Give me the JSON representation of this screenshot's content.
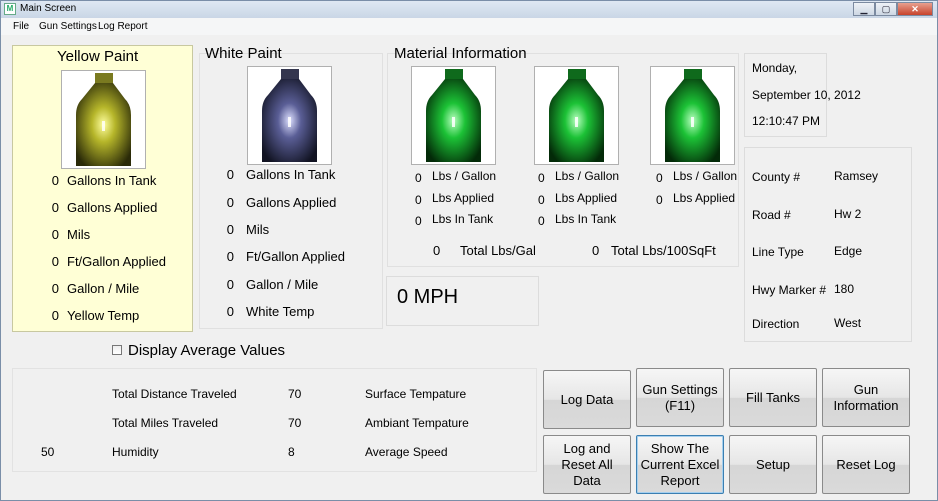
{
  "window": {
    "title": "Main Screen",
    "icon": "app-icon",
    "icon_glyph": "M"
  },
  "menu": {
    "items": [
      "File",
      "Gun Settings",
      "Log Report"
    ]
  },
  "yellow": {
    "title": "Yellow Paint",
    "rows": [
      {
        "value": "0",
        "label": "Gallons In Tank"
      },
      {
        "value": "0",
        "label": "Gallons Applied"
      },
      {
        "value": "0",
        "label": "Mils"
      },
      {
        "value": "0",
        "label": "Ft/Gallon Applied"
      },
      {
        "value": "0",
        "label": "Gallon / Mile"
      },
      {
        "value": "0",
        "label": "Yellow Temp"
      }
    ]
  },
  "white": {
    "title": "White Paint",
    "rows": [
      {
        "value": "0",
        "label": "Gallons In Tank"
      },
      {
        "value": "0",
        "label": "Gallons Applied"
      },
      {
        "value": "0",
        "label": "Mils"
      },
      {
        "value": "0",
        "label": "Ft/Gallon Applied"
      },
      {
        "value": "0",
        "label": "Gallon / Mile"
      },
      {
        "value": "0",
        "label": "White Temp"
      }
    ]
  },
  "material": {
    "title": "Material Information",
    "bins": [
      {
        "rows": [
          {
            "value": "0",
            "label": "Lbs / Gallon"
          },
          {
            "value": "0",
            "label": "Lbs Applied"
          },
          {
            "value": "0",
            "label": "Lbs In Tank"
          }
        ]
      },
      {
        "rows": [
          {
            "value": "0",
            "label": "Lbs / Gallon"
          },
          {
            "value": "0",
            "label": "Lbs Applied"
          },
          {
            "value": "0",
            "label": "Lbs In Tank"
          }
        ]
      },
      {
        "rows": [
          {
            "value": "0",
            "label": "Lbs / Gallon"
          },
          {
            "value": "0",
            "label": "Lbs Applied"
          }
        ]
      }
    ],
    "total_lbs_gal": {
      "value": "0",
      "label": "Total Lbs/Gal"
    },
    "total_lbs_sqft": {
      "value": "0",
      "label": "Total Lbs/100SqFt"
    }
  },
  "datetime": {
    "day": "Monday,",
    "date": "September 10, 2012",
    "time": "12:10:47 PM"
  },
  "location": {
    "rows": [
      {
        "label": "County #",
        "value": "Ramsey"
      },
      {
        "label": "Road #",
        "value": "Hw 2"
      },
      {
        "label": "Line Type",
        "value": "Edge"
      },
      {
        "label": "Hwy Marker #",
        "value": "180"
      },
      {
        "label": "Direction",
        "value": "West"
      }
    ]
  },
  "speed": {
    "text": "0 MPH"
  },
  "display_average": {
    "label": "Display Average Values",
    "checked": false
  },
  "stats": {
    "total_distance_label": "Total Distance Traveled",
    "total_distance_value": "70",
    "surface_temp_label": "Surface Tempature",
    "total_miles_label": "Total Miles Traveled",
    "total_miles_value": "70",
    "ambient_temp_label": "Ambiant Tempature",
    "humidity_value": "50",
    "humidity_label": "Humidity",
    "avg_speed_value": "8",
    "avg_speed_label": "Average Speed"
  },
  "buttons": {
    "log_data": "Log Data",
    "gun_settings": "Gun Settings (F11)",
    "fill_tanks": "Fill Tanks",
    "gun_information": "Gun Information",
    "log_reset": "Log and Reset All Data",
    "show_excel": "Show The Current Excel Report",
    "setup": "Setup",
    "reset_log": "Reset Log"
  },
  "colors": {
    "yellow_panel_bg": "#ffffd6",
    "yellow_paint": "#d8d83a",
    "white_paint": "#8a8ec8",
    "material_green": "#2ee04a"
  },
  "icons": {
    "close": "×",
    "minimize": "▭",
    "maximize": "◻"
  }
}
